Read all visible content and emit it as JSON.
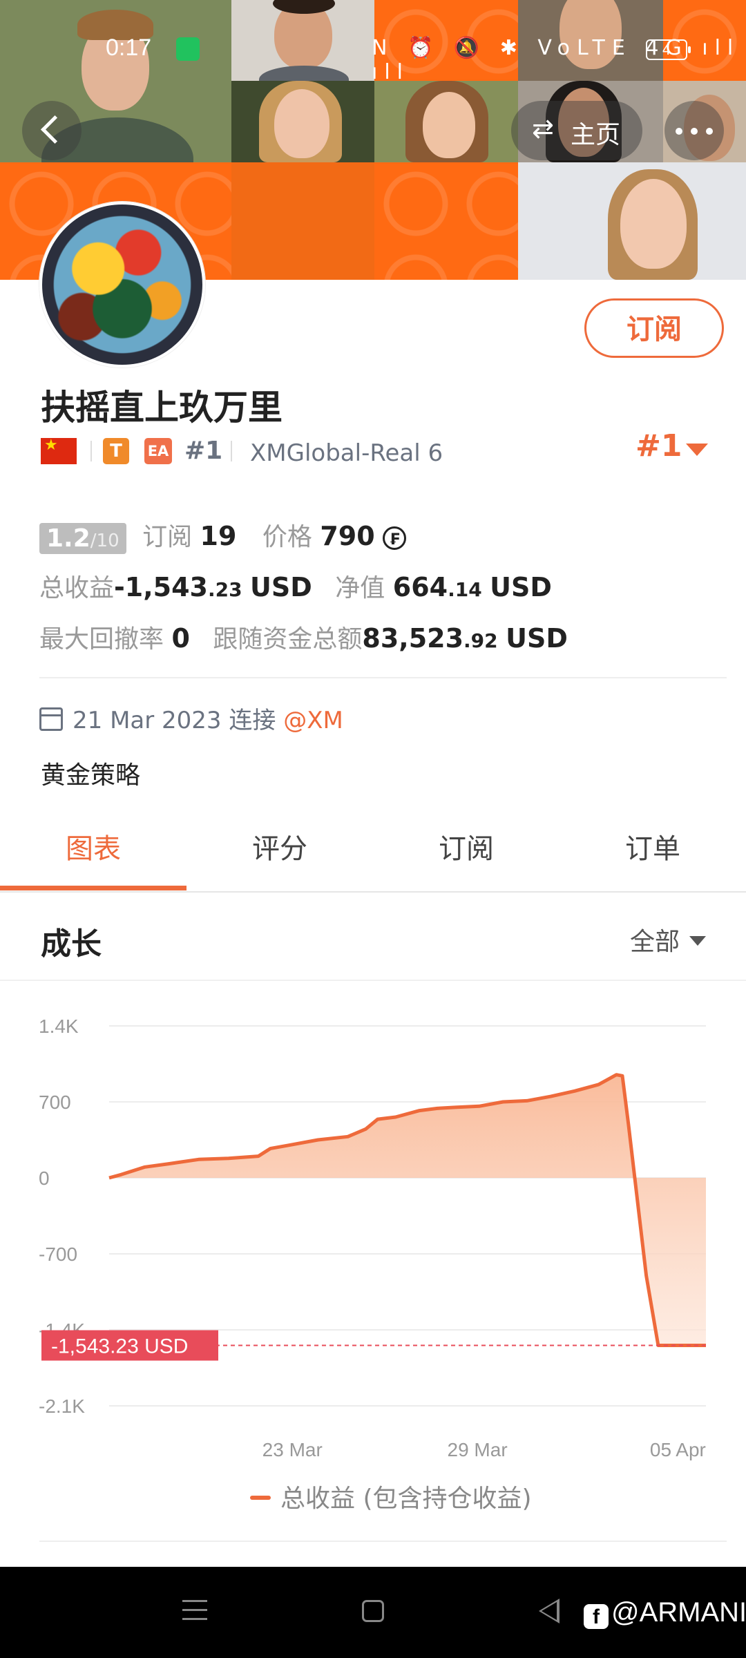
{
  "status_bar": {
    "time": "0:17",
    "icons": "N ⏰ 🔕 ✱ VoLTE 4G ıll ıll",
    "battery": "4"
  },
  "header": {
    "home_label": "主页"
  },
  "profile": {
    "subscribe_label": "订阅",
    "name": "扶摇直上玖万里",
    "rank_small": "#1",
    "account": "XMGlobal-Real 6",
    "rank_big": "#1",
    "badge_t": "T",
    "badge_ea": "EA"
  },
  "stats": {
    "score_main": "1.2",
    "score_max": "/10",
    "subscribers_label": "订阅",
    "subscribers_value": "19",
    "price_label": "价格",
    "price_value": "790",
    "price_icon": "₣",
    "total_profit_label": "总收益",
    "total_profit_main": "-1,543",
    "total_profit_dec": ".23",
    "total_profit_unit": "USD",
    "equity_label": "净值",
    "equity_main": "664",
    "equity_dec": ".14",
    "equity_unit": "USD",
    "drawdown_label": "最大回撤率",
    "drawdown_value": "0",
    "follow_funds_label": "跟随资金总额",
    "follow_funds_main": "83,523",
    "follow_funds_dec": ".92",
    "follow_funds_unit": "USD"
  },
  "connection": {
    "date": "21 Mar 2023",
    "connect_label": "连接",
    "broker": "@XM"
  },
  "strategy": "黄金策略",
  "tabs": [
    {
      "label": "图表",
      "active": true
    },
    {
      "label": "评分",
      "active": false
    },
    {
      "label": "订阅",
      "active": false
    },
    {
      "label": "订单",
      "active": false
    }
  ],
  "section": {
    "title": "成长",
    "filter": "全部"
  },
  "chart_data": {
    "type": "area",
    "y_ticks": [
      "1.4K",
      "700",
      "0",
      "-700",
      "-1.4K",
      "-2.1K"
    ],
    "y_tick_values": [
      1400,
      700,
      0,
      -700,
      -1400,
      -2100
    ],
    "ylim": [
      -2100,
      1400
    ],
    "x_ticks": [
      "23 Mar",
      "29 Mar",
      "05 Apr"
    ],
    "x_tick_positions": [
      0.307,
      0.617,
      0.953
    ],
    "series": [
      {
        "name": "总收益 (包含持仓收益)",
        "x": [
          0,
          0.02,
          0.06,
          0.1,
          0.15,
          0.2,
          0.25,
          0.27,
          0.3,
          0.35,
          0.4,
          0.43,
          0.45,
          0.48,
          0.52,
          0.55,
          0.58,
          0.62,
          0.66,
          0.7,
          0.74,
          0.78,
          0.82,
          0.84,
          0.85,
          0.86,
          0.87,
          0.9,
          0.92,
          1.0
        ],
        "values": [
          0,
          30,
          100,
          130,
          170,
          180,
          200,
          270,
          300,
          350,
          380,
          450,
          540,
          560,
          620,
          640,
          650,
          660,
          700,
          710,
          750,
          800,
          860,
          920,
          950,
          940,
          500,
          -900,
          -1543,
          -1543
        ]
      }
    ],
    "current_value_label": "-1,543.23 USD",
    "current_value": -1543.23,
    "line_color": "#ee6a3b",
    "fill_color": "#f9c0a4",
    "marker_color": "#e84c5a",
    "grid": true
  },
  "legend_label": "总收益 (包含持仓收益)",
  "watermark": "@ARMANI",
  "watermark_logo": "f"
}
